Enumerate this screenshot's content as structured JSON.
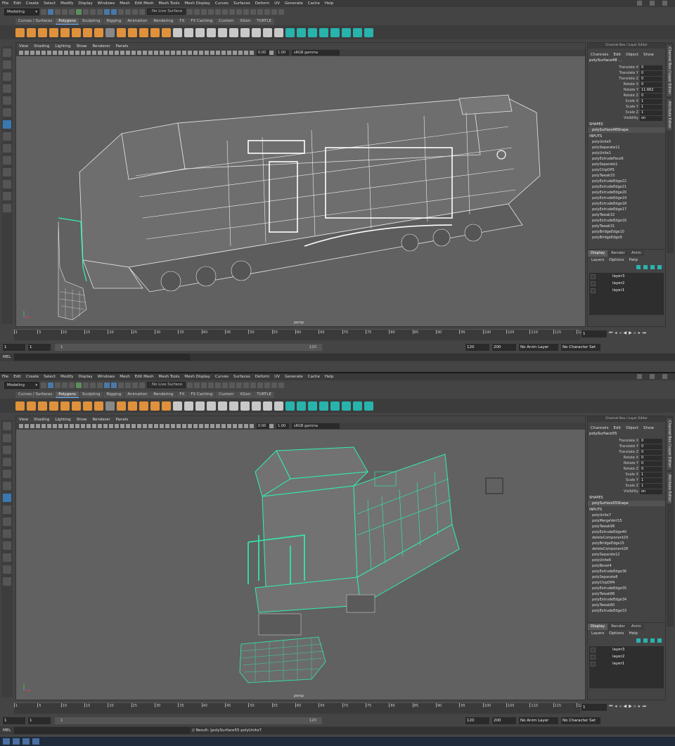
{
  "menus": [
    "File",
    "Edit",
    "Create",
    "Select",
    "Modify",
    "Display",
    "Windows",
    "Mesh",
    "Edit Mesh",
    "Mesh Tools",
    "Mesh Display",
    "Curves",
    "Surfaces",
    "Deform",
    "UV",
    "Generate",
    "Cache",
    "Help"
  ],
  "status": {
    "mode": "Modeling",
    "live_surface": "No Live Surface"
  },
  "shelf_tabs": [
    "Curves / Surfaces",
    "Polygons",
    "Sculpting",
    "Rigging",
    "Animation",
    "Rendering",
    "FX",
    "FX Caching",
    "Custom",
    "XGen",
    "TURTLE"
  ],
  "active_shelf_tab": "Polygons",
  "viewport_menu": [
    "View",
    "Shading",
    "Lighting",
    "Show",
    "Renderer",
    "Panels"
  ],
  "viewport_toolbar": {
    "exposure": "0.00",
    "gamma": "1.00",
    "color_space": "sRGB gamma"
  },
  "camera": "persp",
  "channel_box": {
    "header": "Channel Box / Layer Editor",
    "menus": [
      "Channels",
      "Edit",
      "Object",
      "Show"
    ],
    "attr_names": [
      "Translate X",
      "Translate Y",
      "Translate Z",
      "Rotate X",
      "Rotate Y",
      "Rotate Z",
      "Scale X",
      "Scale Y",
      "Scale Z",
      "Visibility"
    ],
    "shapes_label": "SHAPES",
    "inputs_label": "INPUTS"
  },
  "side_tabs": [
    "Channel Box / Layer Editor",
    "Attribute Editor"
  ],
  "layer_editor": {
    "tabs": [
      "Display",
      "Render",
      "Anim"
    ],
    "menus": [
      "Layers",
      "Options",
      "Help"
    ],
    "layers": [
      "layer3",
      "layer2",
      "layer1"
    ]
  },
  "timeline": {
    "ticks": [
      "1",
      "5",
      "10",
      "15",
      "20",
      "25",
      "30",
      "35",
      "40",
      "45",
      "50",
      "55",
      "60",
      "65",
      "70",
      "75",
      "80",
      "85",
      "90",
      "95",
      "100",
      "105",
      "110",
      "115",
      "120"
    ],
    "current_frame": "1",
    "start": "1",
    "start2": "1",
    "range_start": "1",
    "range_end": "120",
    "end": "120",
    "end2": "200",
    "anim_layer": "No Anim Layer",
    "char_set": "No Character Set"
  },
  "instances": [
    {
      "object_name": "polySurface48 . .",
      "attr_values": [
        "0",
        "0",
        "0",
        "0",
        "11.662",
        "0",
        "1",
        "1",
        "1",
        "on"
      ],
      "shape": "polySurface48Shape",
      "inputs": [
        "polyUnite5",
        "polySeparate11",
        "polyUnite1",
        "polyExtrudeFace6",
        "polySeparate1",
        "polyChipOff1",
        "polyTweak33",
        "polyExtrudeEdge22",
        "polyExtrudeEdge21",
        "polyExtrudeEdge20",
        "polyExtrudeEdge19",
        "polyExtrudeEdge18",
        "polyExtrudeEdge17",
        "polyTweak32",
        "polyExtrudeEdge16",
        "polyTweak31",
        "polyBridgeEdge10",
        "polyBridgeEdge9"
      ],
      "cmd_label": "MEL",
      "cmd_result": ""
    },
    {
      "object_name": "polySurface55",
      "attr_values": [
        "0",
        "0",
        "0",
        "0",
        "0",
        "0",
        "1",
        "1",
        "1",
        "on"
      ],
      "shape": "polySurface55Shape",
      "inputs": [
        "polyUnite7",
        "polyMergeVert15",
        "polyTweak96",
        "polyExtrudeEdge40",
        "deleteComponent29",
        "polyBridgeEdge15",
        "deleteComponent28",
        "polySeparate12",
        "polyUnite6",
        "polyBevel4",
        "polyExtrudeEdge36",
        "polySeparate8",
        "polyChipOff4",
        "polyExtrudeEdge35",
        "polyTweak86",
        "polyExtrudeEdge34",
        "polyTweak80",
        "polyExtrudeEdge33"
      ],
      "cmd_label": "MEL",
      "cmd_result": "// Result: |polySurface55 polyUnite7"
    }
  ],
  "colors": {
    "accent": "#6ab0ff",
    "selection": "#2ef0b2",
    "viewport_bg": "#616161",
    "shelf_orange": "#e0913b",
    "shelf_teal": "#28b3ad"
  }
}
